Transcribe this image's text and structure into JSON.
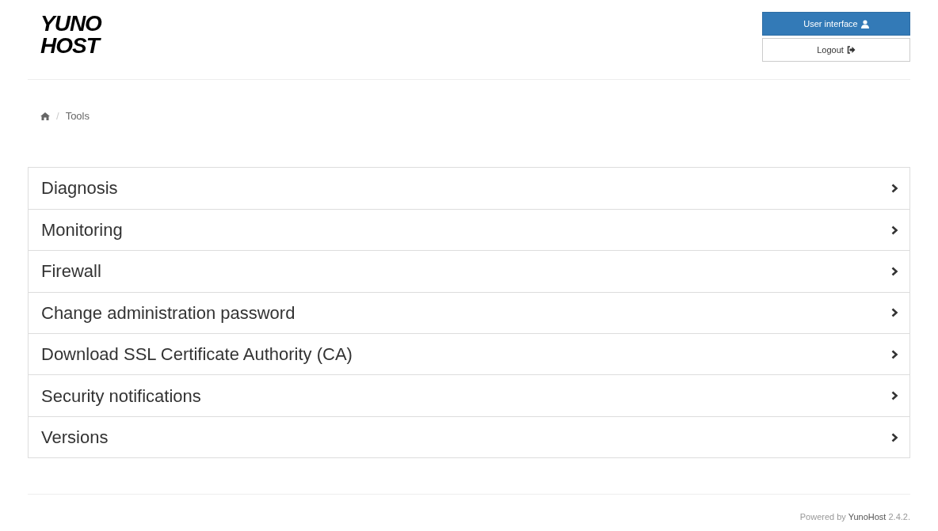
{
  "logo": {
    "lines": [
      "YUNO",
      "HOST"
    ]
  },
  "header_buttons": [
    {
      "label": "User interface",
      "kind": "primary"
    },
    {
      "label": "Logout",
      "kind": "default"
    }
  ],
  "breadcrumb": {
    "separator": "/",
    "items": [
      "Tools"
    ]
  },
  "menu": [
    {
      "label": "Diagnosis"
    },
    {
      "label": "Monitoring"
    },
    {
      "label": "Firewall"
    },
    {
      "label": "Change administration password"
    },
    {
      "label": "Download SSL Certificate Authority (CA)"
    },
    {
      "label": "Security notifications"
    },
    {
      "label": "Versions"
    }
  ],
  "footer": {
    "prefix": "Powered by",
    "link": "YunoHost",
    "suffix": "2.4.2."
  }
}
